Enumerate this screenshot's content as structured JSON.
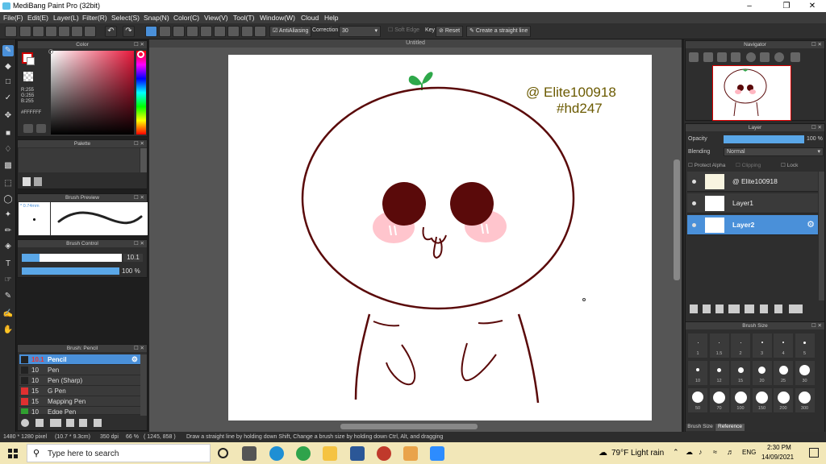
{
  "window": {
    "title": "MediBang Paint Pro (32bit)"
  },
  "menu": [
    "File(F)",
    "Edit(E)",
    "Layer(L)",
    "Filter(R)",
    "Select(S)",
    "Snap(N)",
    "Color(C)",
    "View(V)",
    "Tool(T)",
    "Window(W)",
    "Cloud",
    "Help"
  ],
  "toolbar": {
    "antialias_label": "AntiAliasing",
    "correction_label": "Correction",
    "correction_value": "30",
    "softedge_label": "Soft Edge",
    "key_label": "Key",
    "reset_label": "Reset",
    "straight_label": "Create a straight line"
  },
  "color_panel": {
    "title": "Color",
    "r": "R:255",
    "g": "G:255",
    "b": "B:255",
    "hex": "#FFFFFF"
  },
  "palette_panel": {
    "title": "Palette"
  },
  "brush_preview": {
    "title": "Brush Preview",
    "size": "* 0.74mm"
  },
  "brush_control": {
    "title": "Brush Control",
    "size_value": "10.1",
    "opacity_value": "100 %"
  },
  "brush_list": {
    "title": "Brush: Pencil",
    "items": [
      {
        "size": "10.1",
        "name": "Pencil",
        "color": "#222222",
        "selected": true
      },
      {
        "size": "10",
        "name": "Pen",
        "color": "#222222"
      },
      {
        "size": "10",
        "name": "Pen (Sharp)",
        "color": "#222222"
      },
      {
        "size": "15",
        "name": "G Pen",
        "color": "#e03030"
      },
      {
        "size": "15",
        "name": "Mapping Pen",
        "color": "#e03030"
      },
      {
        "size": "10",
        "name": "Edge Pen",
        "color": "#30a030"
      }
    ]
  },
  "canvas": {
    "tab_title": "Untitled",
    "text_line1": "@ Elite100918",
    "text_line2": "#hd247"
  },
  "navigator": {
    "title": "Navigator"
  },
  "layer_panel": {
    "title": "Layer",
    "opacity_label": "Opacity",
    "opacity_value": "100 %",
    "blending_label": "Blending",
    "blending_value": "Normal",
    "protect_alpha": "Protect Alpha",
    "clipping": "Clipping",
    "lock": "Lock",
    "layers": [
      {
        "name": "@ Elite100918",
        "selected": false
      },
      {
        "name": "Layer1",
        "selected": false
      },
      {
        "name": "Layer2",
        "selected": true
      }
    ]
  },
  "brush_size_panel": {
    "title": "Brush Size",
    "sizes_row1": [
      "1",
      "1.5",
      "2",
      "3",
      "4",
      "5"
    ],
    "sizes_row2": [
      "10",
      "12",
      "15",
      "20",
      "25",
      "30"
    ],
    "sizes_row3": [
      "50",
      "70",
      "100",
      "150",
      "200",
      "300"
    ],
    "tabs": [
      "Brush Size",
      "Reference"
    ]
  },
  "statusbar": {
    "size": "1480 * 1280 pixel",
    "cm": "(10.7 * 9.3cm)",
    "dpi": "350 dpi",
    "zoom": "66 %",
    "coords": "( 1245, 858 )",
    "hint": "Draw a straight line by holding down Shift, Change a brush size by holding down Ctrl, Alt, and dragging"
  },
  "taskbar": {
    "search_placeholder": "Type here to search",
    "weather": "79°F  Light rain",
    "lang": "ENG",
    "time": "2:30 PM",
    "date": "14/09/2021"
  },
  "colors": {
    "accent": "#4a90d9",
    "line": "#5a0a0a",
    "blush": "#ff9aa8",
    "sprout": "#2ea84a"
  }
}
